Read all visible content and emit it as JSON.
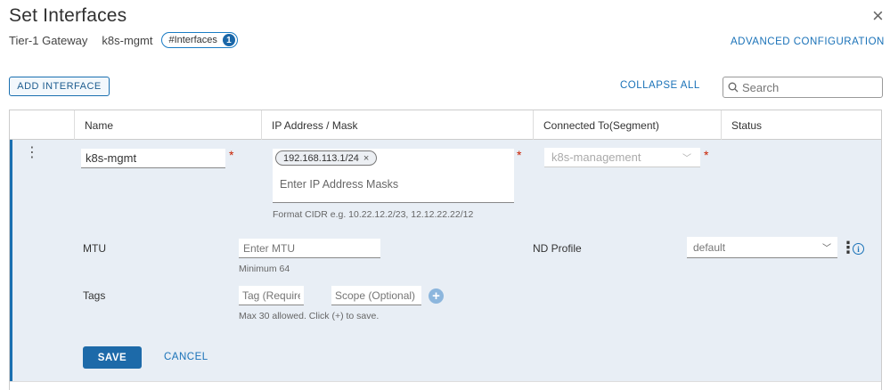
{
  "dialog": {
    "title": "Set Interfaces",
    "close_icon": "×",
    "gateway_type": "Tier-1 Gateway",
    "gateway_name": "k8s-mgmt",
    "interfaces_pill": {
      "label": "#Interfaces",
      "count": "1"
    },
    "advanced_config": "ADVANCED CONFIGURATION"
  },
  "toolbar": {
    "add_interface": "ADD INTERFACE",
    "collapse_all": "COLLAPSE ALL",
    "search_placeholder": "Search"
  },
  "table": {
    "columns": [
      "Name",
      "IP Address / Mask",
      "Connected To(Segment)",
      "Status"
    ]
  },
  "edit_row": {
    "name_value": "k8s-mgmt",
    "required_mark": "*",
    "ip_chip": "192.168.113.1/24",
    "ip_chip_remove": "×",
    "ip_placeholder": "Enter IP Address Masks",
    "ip_hint": "Format CIDR e.g. 10.22.12.2/23, 12.12.22.22/12",
    "segment_value": "k8s-management",
    "mtu_label": "MTU",
    "mtu_placeholder": "Enter MTU",
    "mtu_hint": "Minimum 64",
    "nd_profile_label": "ND Profile",
    "nd_profile_value": "default",
    "tags_label": "Tags",
    "tag_placeholder": "Tag (Required)",
    "scope_placeholder": "Scope (Optional)",
    "tags_hint": "Max 30 allowed. Click (+) to save.",
    "save": "SAVE",
    "cancel": "CANCEL"
  },
  "colors": {
    "accent": "#1a72b8",
    "primary_button": "#1d6aa9",
    "edit_row_bg": "#e8eef5",
    "required": "#c92100"
  }
}
